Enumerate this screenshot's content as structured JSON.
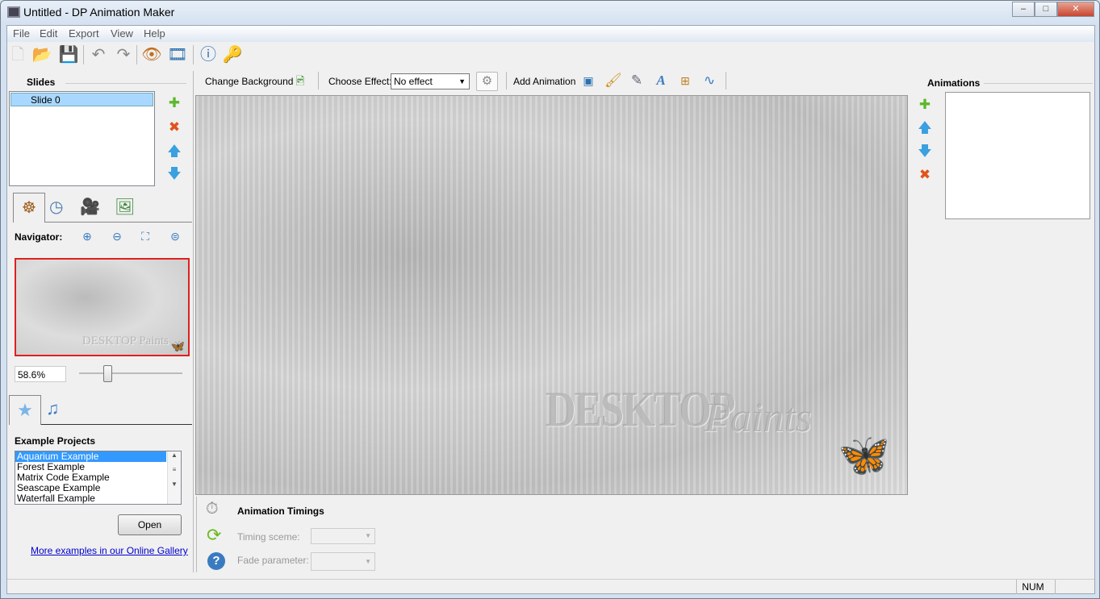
{
  "window": {
    "title": "Untitled - DP Animation Maker",
    "minimize": "–",
    "maximize": "□",
    "close": "✕"
  },
  "menu": [
    "File",
    "Edit",
    "Export",
    "View",
    "Help"
  ],
  "toolbar": {
    "icons": [
      "new-file-icon",
      "open-folder-icon",
      "save-icon",
      "undo-icon",
      "redo-icon",
      "preview-eye-icon",
      "export-video-icon",
      "info-icon",
      "key-icon"
    ],
    "glyphs": [
      "🗋",
      "📂",
      "💾",
      "↶",
      "↷",
      "👁",
      "🎞",
      "ⓘ",
      "🔑"
    ]
  },
  "slides": {
    "header": "Slides",
    "items": [
      {
        "label": "Slide 0",
        "selected": true
      }
    ]
  },
  "navigator": {
    "label": "Navigator:",
    "zoom_value": "58.6%",
    "zoom_slider_percent": 30,
    "preview_logo": "DESKTOP Paints"
  },
  "examples": {
    "header": "Example Projects",
    "items": [
      "Aquarium Example",
      "Forest Example",
      "Matrix Code Example",
      "Seascape Example",
      "Waterfall Example"
    ],
    "selected": 0,
    "open_label": "Open",
    "gallery_link": "More examples in our Online Gallery"
  },
  "canvas_toolbar": {
    "change_background": "Change Background",
    "choose_effect": "Choose Effect:",
    "effect_value": "No effect",
    "add_animation": "Add Animation"
  },
  "canvas": {
    "logo_main": "DESKTOP",
    "logo_script": "Paints"
  },
  "timings": {
    "header": "Animation Timings",
    "timing_scheme": "Timing sceme:",
    "fade_parameter": "Fade parameter:"
  },
  "animations": {
    "header": "Animations"
  },
  "status": {
    "num": "NUM"
  },
  "colors": {
    "selection": "#3399ff",
    "navigator_border": "#e02020",
    "link": "#0000cc"
  }
}
